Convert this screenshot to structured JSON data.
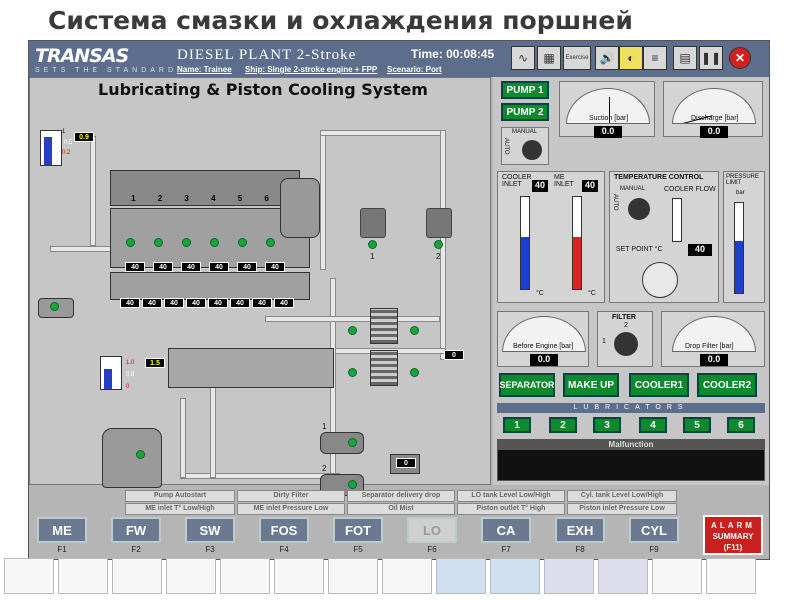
{
  "slide_title": "Система смазки и охлаждения поршней",
  "header": {
    "logo": "TRANSAS",
    "logo_sub": "SETS THE STANDARD",
    "app_title": "DIESEL PLANT  2-Stroke",
    "name": "Name: Trainee",
    "ship": "Ship: Single 2-stroke engine + FPP",
    "scenario": "Scenario: Port",
    "time": "Time: 00:08:45",
    "exercise_label": "Exercise"
  },
  "panel_title": "Lubricating & Piston Cooling System",
  "tank1": {
    "level": "0.9",
    "hi": "1",
    "mid": "0.5",
    "low": "0.2"
  },
  "tank2": {
    "level": "1.5",
    "hi": "1.0",
    "mid": "0.8",
    "low": "0"
  },
  "engine": {
    "cyl_numbers": [
      "1",
      "2",
      "3",
      "4",
      "5",
      "6"
    ],
    "row1": [
      "40",
      "40",
      "40",
      "40",
      "40",
      "40"
    ],
    "row2": [
      "40",
      "40",
      "40",
      "40",
      "40",
      "40",
      "40",
      "40"
    ]
  },
  "pump_labels": {
    "a": "1",
    "b": "2"
  },
  "filter_labels": {
    "a": "1",
    "b": "2"
  },
  "valve_value": "0",
  "cooler_value": "0",
  "controls": {
    "pump1": "PUMP 1",
    "pump2": "PUMP 2",
    "manual": "MANUAL",
    "auto": "AUTO",
    "suction": {
      "label": "Suction [bar]",
      "value": "0.0",
      "ticks": [
        "-1",
        "-0.5",
        "0",
        "0.5",
        "1"
      ]
    },
    "discharge": {
      "label": "Discharge [bar]",
      "value": "0.0",
      "ticks": [
        "0",
        "2",
        "4",
        "6",
        "8",
        "10"
      ]
    },
    "cooler_inlet": {
      "label": "COOLER INLET",
      "value": "40",
      "scale": [
        "70",
        "60",
        "50",
        "40",
        "30",
        "20",
        "10",
        "0"
      ],
      "unit": "°C"
    },
    "me_inlet": {
      "label": "ME INLET",
      "value": "40",
      "scale": [
        "80",
        "60",
        "50",
        "40",
        "30",
        "20",
        "10",
        "0"
      ],
      "unit": "°C"
    },
    "temp_control": "TEMPERATURE CONTROL",
    "cooler_flow": "COOLER FLOW",
    "cooler_flow_scale": [
      "100",
      "80",
      "60",
      "40",
      "20",
      "0"
    ],
    "set_point": "SET POINT °C",
    "set_point_value": "40",
    "set_point_scale": [
      "35",
      "40",
      "45",
      "50"
    ],
    "pressure_limit": "PRESSURE LIMIT",
    "pressure_unit": "bar",
    "pressure_scale": [
      "6",
      "5",
      "4",
      "3",
      "2"
    ],
    "before_engine": {
      "label": "Before Engine [bar]",
      "value": "0.0",
      "ticks": [
        "0",
        "2",
        "4",
        "6",
        "8"
      ]
    },
    "filter": "FILTER",
    "filter_nums": [
      "1",
      "2"
    ],
    "drop_filter": {
      "label": "Drop Filter [bar]",
      "value": "0.0",
      "ticks": [
        "0",
        "0.5",
        "1",
        "1.5"
      ]
    },
    "separator": "SEPARATOR",
    "make_up": "MAKE UP",
    "cooler1": "COOLER1",
    "cooler2": "COOLER2",
    "lubricators": "LUBRICATORS",
    "lubricator_buttons": [
      "1",
      "2",
      "3",
      "4",
      "5",
      "6"
    ],
    "malfunction": "Malfunction"
  },
  "alarms": [
    [
      "Pump Autostart",
      "Dirty Filter",
      "Separator delivery drop",
      "LO tank Level Low/High",
      "Cyl. tank Level Low/High"
    ],
    [
      "ME inlet T° Low/High",
      "ME inlet Pressure Low",
      "Oil Mist",
      "Piston outlet T° High",
      "Piston inlet Pressure Low"
    ]
  ],
  "fkeys": [
    {
      "label": "ME",
      "key": "F1"
    },
    {
      "label": "FW",
      "key": "F2"
    },
    {
      "label": "SW",
      "key": "F3"
    },
    {
      "label": "FOS",
      "key": "F4"
    },
    {
      "label": "FOT",
      "key": "F5"
    },
    {
      "label": "LO",
      "key": "F6"
    },
    {
      "label": "CA",
      "key": "F7"
    },
    {
      "label": "EXH",
      "key": "F8"
    },
    {
      "label": "CYL",
      "key": "F9"
    }
  ],
  "alarm_summary": {
    "line1": "ALARM",
    "line2": "SUMMARY",
    "line3": "(F11)"
  },
  "colors": {
    "accent_green": "#0d8a2e",
    "title_bar": "#5d6e8c",
    "alarm_red": "#c8201e"
  }
}
